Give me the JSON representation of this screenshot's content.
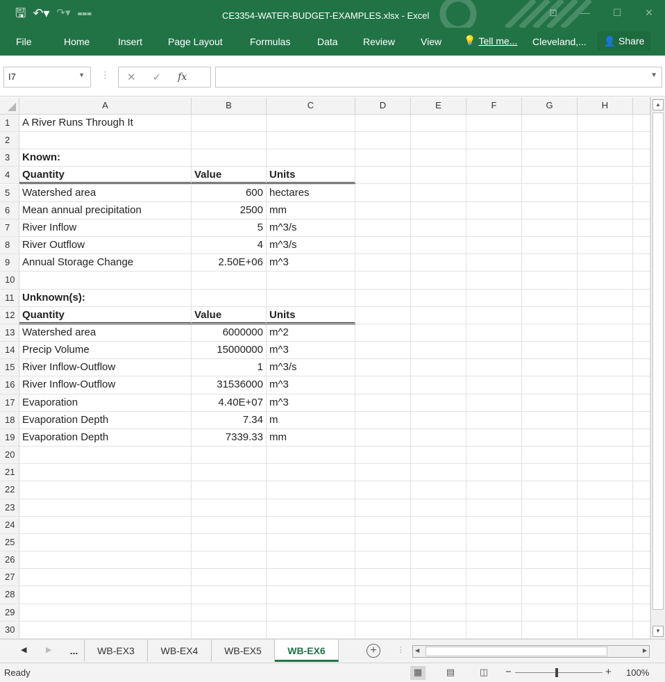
{
  "window": {
    "title": "CE3354-WATER-BUDGET-EXAMPLES.xlsx - Excel"
  },
  "ribbon": {
    "tabs": [
      "File",
      "Home",
      "Insert",
      "Page Layout",
      "Formulas",
      "Data",
      "Review",
      "View"
    ],
    "tell_me": "Tell me...",
    "user": "Cleveland,...",
    "share": "Share"
  },
  "formula_bar": {
    "name_box": "I7",
    "fx": "fx",
    "content": ""
  },
  "sheet": {
    "columns": [
      "A",
      "B",
      "C",
      "D",
      "E",
      "F",
      "G",
      "H"
    ],
    "row_numbers": [
      "1",
      "2",
      "3",
      "4",
      "5",
      "6",
      "7",
      "8",
      "9",
      "10",
      "11",
      "12",
      "13",
      "14",
      "15",
      "16",
      "17",
      "18",
      "19",
      "20",
      "21",
      "22",
      "23",
      "24",
      "25",
      "26",
      "27",
      "28",
      "29",
      "30"
    ],
    "cells": {
      "A1": "A River Runs Through It",
      "A3": "Known:",
      "A4": "Quantity",
      "B4": "Value",
      "C4": "Units",
      "A5": "Watershed area",
      "B5": "600",
      "C5": "hectares",
      "A6": "Mean annual precipitation",
      "B6": "2500",
      "C6": "mm",
      "A7": "River Inflow",
      "B7": "5",
      "C7": "m^3/s",
      "A8": "River Outflow",
      "B8": "4",
      "C8": "m^3/s",
      "A9": "Annual Storage Change",
      "B9": "2.50E+06",
      "C9": "m^3",
      "A11": "Unknown(s):",
      "A12": "Quantity",
      "B12": "Value",
      "C12": "Units",
      "A13": "Watershed area",
      "B13": "6000000",
      "C13": "m^2",
      "A14": "Precip Volume",
      "B14": "15000000",
      "C14": "m^3",
      "A15": "River Inflow-Outflow",
      "B15": "1",
      "C15": "m^3/s",
      "A16": "River Inflow-Outflow",
      "B16": "31536000",
      "C16": "m^3",
      "A17": "Evaporation",
      "B17": "4.40E+07",
      "C17": "m^3",
      "A18": "Evaporation Depth",
      "B18": "7.34",
      "C18": "m",
      "A19": "Evaporation Depth",
      "B19": "7339.33",
      "C19": "mm"
    }
  },
  "sheet_tabs": {
    "more": "...",
    "tabs": [
      "WB-EX3",
      "WB-EX4",
      "WB-EX5",
      "WB-EX6"
    ],
    "active": "WB-EX6"
  },
  "status": {
    "text": "Ready",
    "zoom": "100%"
  },
  "colors": {
    "accent": "#217346"
  }
}
